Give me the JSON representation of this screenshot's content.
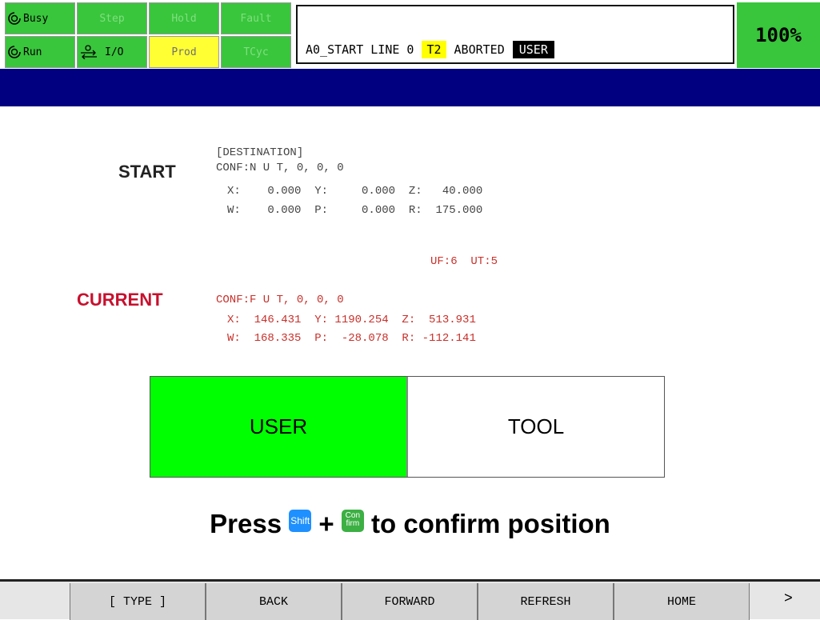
{
  "status": {
    "busy": "Busy",
    "step": "Step",
    "hold": "Hold",
    "fault": "Fault",
    "run": "Run",
    "io": "I/O",
    "prod": "Prod",
    "tcyc": "TCyc"
  },
  "message": {
    "program": "A0_START LINE 0",
    "mode": "T2",
    "state": "ABORTED",
    "frame": "USER"
  },
  "override": "100%",
  "start": {
    "label": "START",
    "header": "[DESTINATION]",
    "conf": "CONF:N U T, 0, 0, 0",
    "row1": "X:    0.000  Y:     0.000  Z:   40.000",
    "row2": "W:    0.000  P:     0.000  R:  175.000"
  },
  "frames_info": "UF:6  UT:5",
  "current": {
    "label": "CURRENT",
    "conf": "CONF:F U T, 0, 0, 0",
    "row1": "X:  146.431  Y: 1190.254  Z:  513.931",
    "row2": "W:  168.335  P:  -28.078  R: -112.141"
  },
  "buttons": {
    "user": "USER",
    "tool": "TOOL"
  },
  "confirm": {
    "press": "Press",
    "shift_key": "Shift",
    "plus": "+",
    "confirm_key_top": "Con",
    "confirm_key_bottom": "firm",
    "text": "to confirm position"
  },
  "softkeys": [
    "[ TYPE ]",
    "BACK",
    "FORWARD",
    "REFRESH",
    "HOME"
  ],
  "more": ">",
  "colors": {
    "status_green": "#39c53c",
    "prod_yellow": "#ffff33",
    "header_blue": "#000080",
    "user_selected": "#00ff00",
    "current_red": "#c8302a",
    "shift_blue": "#1e90ff",
    "confirm_green": "#3cb043"
  }
}
